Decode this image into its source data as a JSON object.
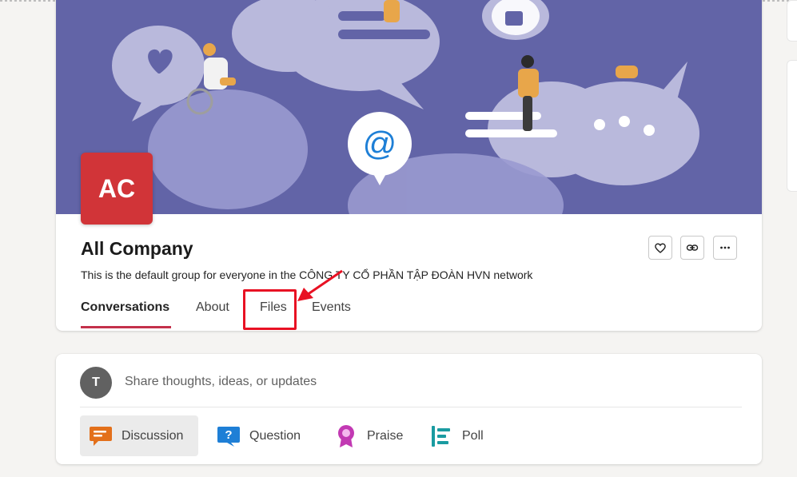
{
  "group": {
    "initials": "AC",
    "name": "All Company",
    "description": "This is the default group for everyone in the CÔNG TY CỔ PHẦN TẬP ĐOÀN HVN network",
    "avatar_color": "#d13438",
    "banner_color": "#6264a7"
  },
  "actions": {
    "favorite_icon": "heart-icon",
    "link_icon": "link-icon",
    "more_icon": "more-icon"
  },
  "tabs": [
    {
      "label": "Conversations",
      "active": true
    },
    {
      "label": "About",
      "active": false
    },
    {
      "label": "Files",
      "active": false,
      "highlighted": true
    },
    {
      "label": "Events",
      "active": false
    }
  ],
  "composer": {
    "user_initial": "T",
    "placeholder": "Share thoughts, ideas, or updates",
    "post_types": [
      {
        "label": "Discussion",
        "icon": "discussion-icon",
        "color": "#e3701b",
        "selected": true
      },
      {
        "label": "Question",
        "icon": "question-icon",
        "color": "#1e7fd6",
        "selected": false
      },
      {
        "label": "Praise",
        "icon": "praise-icon",
        "color": "#c239b3",
        "selected": false
      },
      {
        "label": "Poll",
        "icon": "poll-icon",
        "color": "#1a9ba1",
        "selected": false
      }
    ]
  },
  "annotation": {
    "color": "#e81123"
  }
}
